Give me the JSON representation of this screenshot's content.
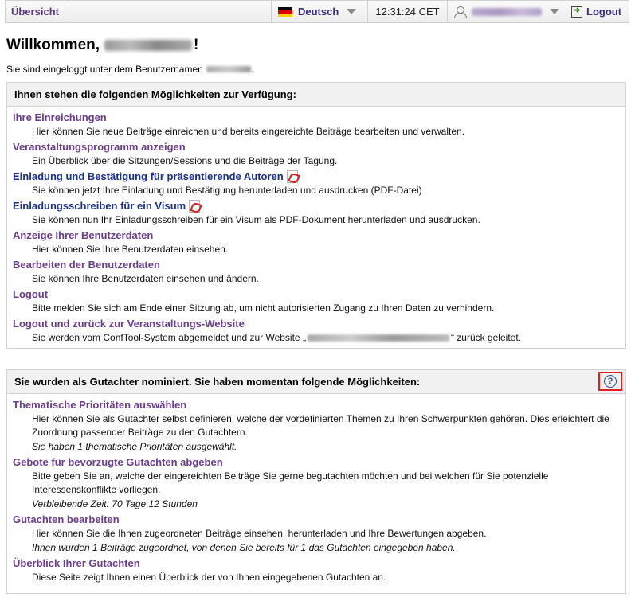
{
  "topbar": {
    "overview_label": "Übersicht",
    "language_label": "Deutsch",
    "time": "12:31:24 CET",
    "logout_label": "Logout"
  },
  "welcome": {
    "title_prefix": "Willkommen,",
    "title_suffix": "!",
    "login_text": "Sie sind eingeloggt unter dem Benutzernamen"
  },
  "options_panel": {
    "heading": "Ihnen stehen die folgenden Möglichkeiten zur Verfügung:",
    "items": [
      {
        "title": "Ihre Einreichungen",
        "desc": "Hier können Sie neue Beiträge einreichen und bereits eingereichte Beiträge bearbeiten und verwalten."
      },
      {
        "title": "Veranstaltungsprogramm anzeigen",
        "desc": "Ein Überblick über die Sitzungen/Sessions und die Beiträge der Tagung."
      },
      {
        "title": "Einladung und Bestätigung für präsentierende Autoren",
        "desc": "Sie können jetzt Ihre Einladung und Bestätigung herunterladen und ausdrucken (PDF-Datei)"
      },
      {
        "title": "Einladungsschreiben für ein Visum",
        "desc": "Sie können nun Ihr Einladungsschreiben für ein Visum als PDF-Dokument herunterladen und ausdrucken."
      },
      {
        "title": "Anzeige Ihrer Benutzerdaten",
        "desc": "Hier können Sie Ihre Benutzerdaten einsehen."
      },
      {
        "title": "Bearbeiten der Benutzerdaten",
        "desc": "Sie können Ihre Benutzerdaten einsehen und ändern."
      },
      {
        "title": "Logout",
        "desc": "Bitte melden Sie sich am Ende einer Sitzung ab, um nicht autorisierten Zugang zu Ihren Daten zu verhindern."
      },
      {
        "title": "Logout und zurück zur Veranstaltungs-Website",
        "desc_prefix": "Sie werden vom ConfTool-System abgemeldet und zur Website „",
        "desc_suffix": "“ zurück geleitet."
      }
    ]
  },
  "reviewer_panel": {
    "heading": "Sie wurden als Gutachter nominiert. Sie haben momentan folgende Möglichkeiten:",
    "items": [
      {
        "title": "Thematische Prioritäten auswählen",
        "desc": "Hier können Sie als Gutachter selbst definieren, welche der vordefinierten Themen zu Ihren Schwerpunkten gehören. Dies erleichtert die Zuordnung passender Beiträge zu den Gutachtern.",
        "note": "Sie haben 1 thematische Prioritäten ausgewählt."
      },
      {
        "title": "Gebote für bevorzugte Gutachten abgeben",
        "desc": "Bitte geben Sie an, welche der eingereichten Beiträge Sie gerne begutachten möchten und bei welchen für Sie potenzielle Interessenskonflikte vorliegen.",
        "note": "Verbleibende Zeit: 70 Tage 12 Stunden"
      },
      {
        "title": "Gutachten bearbeiten",
        "desc": "Hier können Sie die Ihnen zugeordneten Beiträge einsehen, herunterladen und Ihre Bewertungen abgeben.",
        "note": "Ihnen wurden 1 Beiträge zugeordnet, von denen Sie bereits für 1 das Gutachten eingegeben haben."
      },
      {
        "title": "Überblick Ihrer Gutachten",
        "desc": "Diese Seite zeigt Ihnen einen Überblick der von Ihnen eingegebenen Gutachten an."
      }
    ]
  },
  "colors": {
    "link_purple": "#6a3d8c",
    "link_blue": "#1a2f8a",
    "help_highlight": "#e02020"
  }
}
